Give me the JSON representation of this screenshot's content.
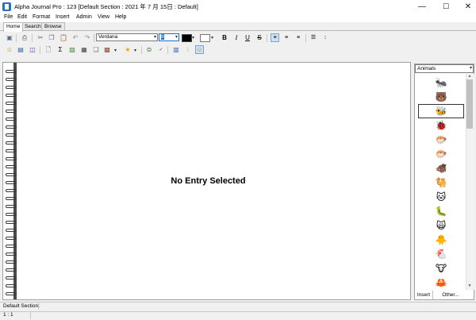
{
  "window": {
    "title": "Alpha Journal Pro : 123 [Default Section : 2021 年 7 月 15日 : Default]",
    "controls": {
      "minimize": "—",
      "maximize": "☐",
      "close": "✕"
    }
  },
  "menu": [
    "File",
    "Edit",
    "Format",
    "Insert",
    "Admin",
    "View",
    "Help"
  ],
  "tabs": [
    "Home",
    "Search",
    "Browse"
  ],
  "toolbar": {
    "font_name": "Verdana",
    "font_size": "8",
    "text_color": "#000000",
    "highlight_color": "#ffffff",
    "bold": "B",
    "italic": "I",
    "underline": "U",
    "strike": "S",
    "sigma": "Σ"
  },
  "editor": {
    "empty_message": "No Entry Selected"
  },
  "emoji_panel": {
    "category": "Animals",
    "items": [
      "🐜",
      "🐻",
      "🐝",
      "🐞",
      "🐡",
      "🐡",
      "🐗",
      "🐫",
      "🐱",
      "🐛",
      "🙀",
      "🐥",
      "🐔",
      "🐮",
      "🦀"
    ],
    "selected_index": 2,
    "insert_label": "Insert",
    "other_label": "Other..."
  },
  "status": {
    "section": "Default Section",
    "position": "1 : 1"
  }
}
